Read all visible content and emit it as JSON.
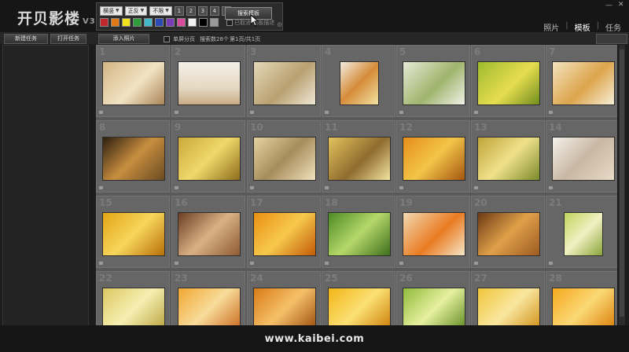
{
  "app": {
    "logo": "开贝影楼",
    "version": "V3"
  },
  "filters": {
    "selects": [
      "横竖",
      "正反",
      "不限"
    ],
    "page_numbers": [
      "1",
      "2",
      "3",
      "4",
      "5"
    ],
    "swatches": [
      "#c0262e",
      "#e07a16",
      "#f2e21c",
      "#2f9d3a",
      "#42b8c9",
      "#2a4bb3",
      "#7a3bb8",
      "#d64b9b",
      "#f2f2f2",
      "#000000",
      "#9a9a9a"
    ],
    "checkbox_label": "已取消 模板描述"
  },
  "search_button": "搜索模板",
  "nav": {
    "items": [
      "照片",
      "模板",
      "任务"
    ],
    "active": "模板"
  },
  "toolbar": {
    "new_task": "新建任务",
    "open_task": "打开任务",
    "add_photo": "添入照片",
    "single_page": "单屏分页",
    "template_count": "搜索数28个",
    "page_info": "第1页/共1页"
  },
  "grid": {
    "numbers": [
      "1",
      "2",
      "3",
      "4",
      "5",
      "6",
      "7",
      "8",
      "9",
      "10",
      "11",
      "12",
      "13",
      "14",
      "15",
      "16",
      "17",
      "18",
      "19",
      "20",
      "21",
      "22",
      "23",
      "24",
      "25",
      "26",
      "27",
      "28"
    ],
    "thumbs": [
      "linear-gradient(135deg,#d4b484,#f1e3c3 55%,#a98457)",
      "linear-gradient(180deg,#f3efe6,#e6d9c3 60%,#c9ab86)",
      "linear-gradient(135deg,#e4d8b8,#b9a070 55%,#efe8d6)",
      "linear-gradient(135deg,#f2ece0,#d58c3a 50%,#f3e2a2)",
      "linear-gradient(135deg,#e7ead6,#9fb46d 55%,#f1f1e8)",
      "linear-gradient(135deg,#9dbb2d,#e7dd4f 55%,#6f8d1d)",
      "linear-gradient(135deg,#f3e4bd,#dca44d 55%,#f7efd6)",
      "linear-gradient(135deg,#2d1f10,#c78e3f 50%,#6a4a22)",
      "linear-gradient(135deg,#caa93a,#f0d86a 50%,#8d6d1e)",
      "linear-gradient(135deg,#e7d3a2,#a68c5b 50%,#f1e2bd)",
      "linear-gradient(135deg,#e3c25c,#8f6c2f 55%,#f3e4a1)",
      "linear-gradient(135deg,#e58d19,#f3c548 50%,#a45610)",
      "linear-gradient(135deg,#bfa43a,#f0e18a 50%,#7b8a2a)",
      "linear-gradient(135deg,#f4f0ea,#c9b7a3 50%,#e8dbc8)",
      "linear-gradient(135deg,#e2a414,#f7d65c 50%,#b86f08)",
      "linear-gradient(135deg,#6b3d24,#d9b184 50%,#8d5a33)",
      "linear-gradient(135deg,#e98e12,#f7c94c 50%,#c25a07)",
      "linear-gradient(135deg,#4d8a24,#b6d86a 50%,#3d6e1c)",
      "linear-gradient(135deg,#f1d9b1,#e97b22 55%,#f6e7c9)",
      "linear-gradient(135deg,#6b3a12,#e0a04a 50%,#9b5a1f)",
      "linear-gradient(135deg,#bfd45e,#f1f0c2 50%,#89a43a)",
      "linear-gradient(135deg,#dcc862,#f6efb2 50%,#b9a13c)",
      "linear-gradient(135deg,#f1a732,#f8dc9b 50%,#c8671a)",
      "linear-gradient(135deg,#d97b17,#f5c06a 50%,#9a4b0b)",
      "linear-gradient(135deg,#f2b417,#fbe174 50%,#cc7a06)",
      "linear-gradient(135deg,#8fbb3a,#e7f0a0 50%,#5e8a1f)",
      "linear-gradient(135deg,#f0c53a,#f9e7a0 50%,#cf8d14)",
      "linear-gradient(135deg,#f5a91d,#fbd875 50%,#d97d06)"
    ]
  },
  "footer": {
    "url": "www.kaibei.com"
  },
  "colors": {
    "background": "#1c1c1c",
    "grid_bg": "#5a5a5a",
    "cell_bg": "#666666"
  }
}
